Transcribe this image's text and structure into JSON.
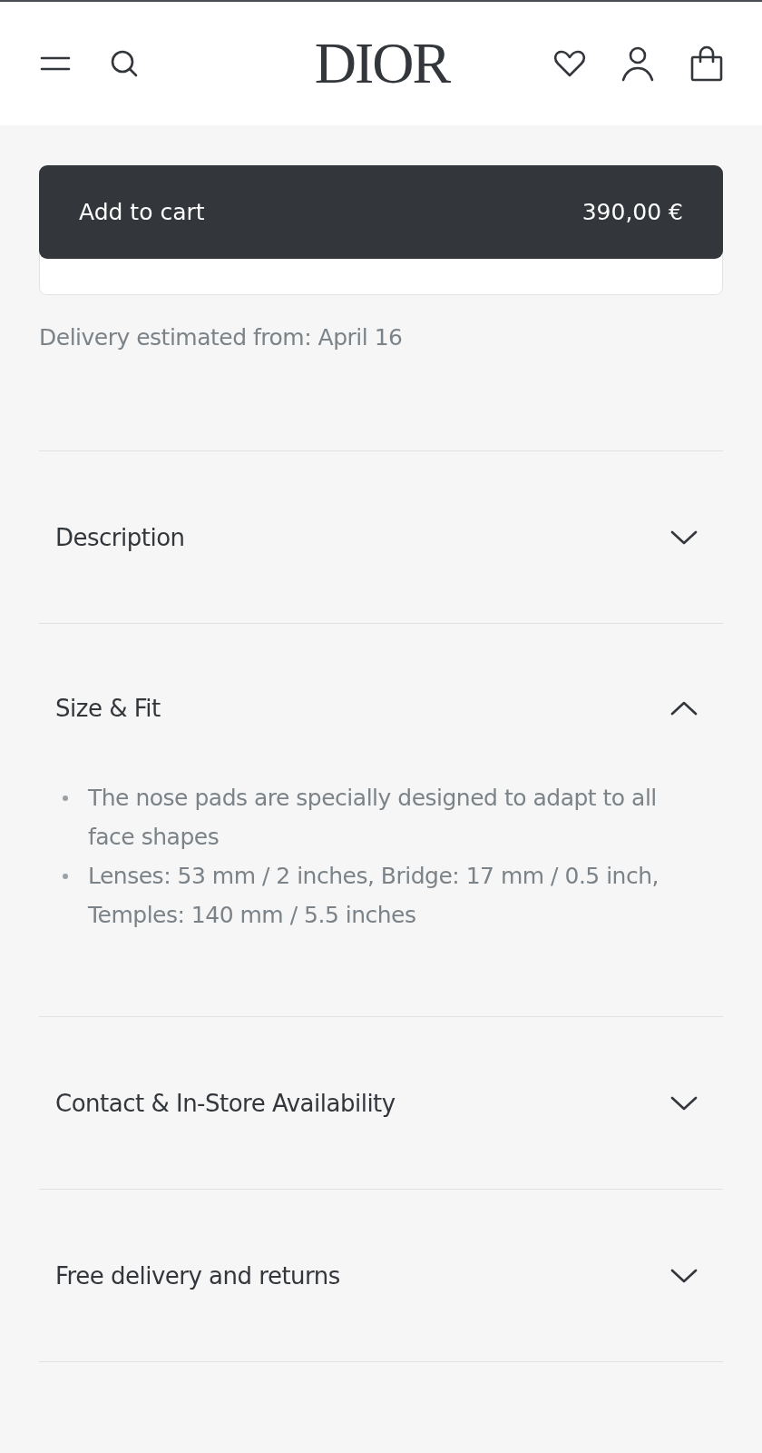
{
  "header": {
    "logo": "DIOR"
  },
  "cart_button": {
    "label": "Add to cart",
    "price": "390,00 €"
  },
  "delivery": "Delivery estimated from: April 16",
  "sections": [
    {
      "title": "Description",
      "expanded": false
    },
    {
      "title": "Size & Fit",
      "expanded": true,
      "bullets": [
        "The nose pads are specially designed to adapt to all face shapes",
        "Lenses: 53 mm / 2 inches, Bridge: 17 mm / 0.5 inch, Temples: 140 mm / 5.5 inches"
      ]
    },
    {
      "title": "Contact & In-Store Availability",
      "expanded": false
    },
    {
      "title": "Free delivery and returns",
      "expanded": false
    }
  ]
}
